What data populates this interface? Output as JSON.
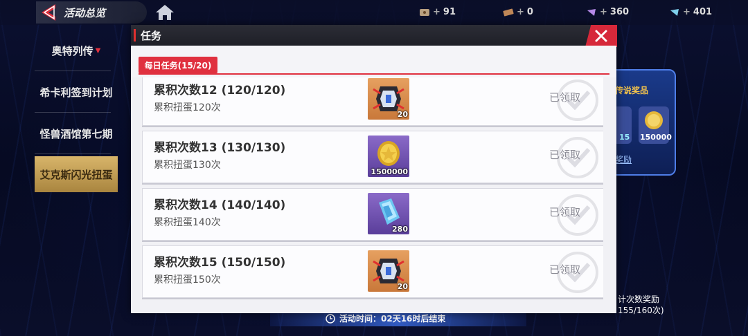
{
  "topbar": {
    "title": "活动总览",
    "resources": [
      {
        "icon": "ticket-icon",
        "value": "91"
      },
      {
        "icon": "coupon-icon",
        "value": "0"
      },
      {
        "icon": "purple-crystal-icon",
        "value": "360"
      },
      {
        "icon": "blue-crystal-icon",
        "value": "401"
      }
    ]
  },
  "sidebar": {
    "items": [
      {
        "label": "奥特列传",
        "dropdown": true,
        "active": false
      },
      {
        "label": "希卡利签到计划",
        "active": false
      },
      {
        "label": "怪兽酒馆第七期",
        "active": false
      },
      {
        "label": "艾克斯闪光扭蛋",
        "active": true
      }
    ]
  },
  "background_panel": {
    "title": "传说奖品",
    "coin_value": "150000",
    "gem_value": "15",
    "link": "奖励",
    "count_label": "计次数奖励",
    "count_value": "155/160次)"
  },
  "bottom": {
    "event_time": "活动时间：02天16时后结束"
  },
  "modal": {
    "title": "任务",
    "tab_label": "每日任务(15/20)",
    "tasks": [
      {
        "title": "累积次数12 (120/120)",
        "desc": "累积扭蛋120次",
        "reward_icon": "capsule-device-icon",
        "reward_qty": "20",
        "status": "已领取"
      },
      {
        "title": "累积次数13 (130/130)",
        "desc": "累积扭蛋130次",
        "reward_icon": "gold-coin-icon",
        "reward_qty": "1500000",
        "status": "已领取"
      },
      {
        "title": "累积次数14 (140/140)",
        "desc": "累积扭蛋140次",
        "reward_icon": "blue-crystal-icon",
        "reward_qty": "280",
        "status": "已领取"
      },
      {
        "title": "累积次数15 (150/150)",
        "desc": "累积扭蛋150次",
        "reward_icon": "capsule-device-icon",
        "reward_qty": "20",
        "status": "已领取"
      }
    ]
  },
  "colors": {
    "accent_red": "#e0303f",
    "close_red": "#d6283a",
    "gold": "#d8b56a"
  }
}
